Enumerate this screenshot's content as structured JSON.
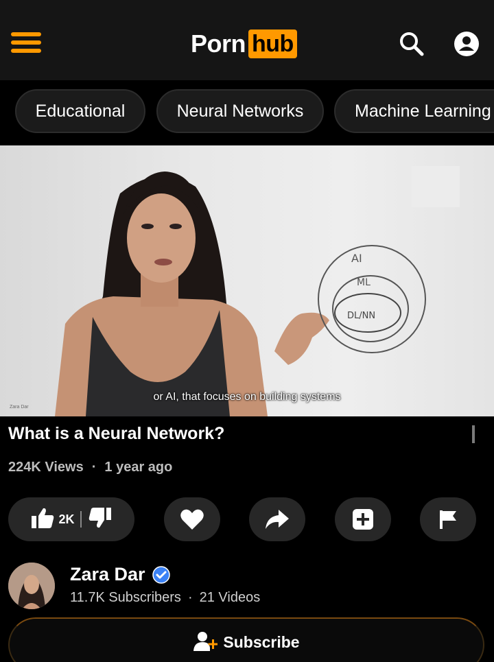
{
  "header": {
    "logo_left": "Porn",
    "logo_right": "hub",
    "menu_icon": "hamburger-icon",
    "search_icon": "search-icon",
    "account_icon": "user-icon"
  },
  "tags": [
    "Educational",
    "Neural Networks",
    "Machine Learning"
  ],
  "video": {
    "caption": "or AI, that focuses on building systems",
    "watermark": "Zara Dar",
    "whiteboard": {
      "outer": "AI",
      "middle": "ML",
      "inner": "DL/NN"
    },
    "title": "What is a Neural Network?",
    "views": "224K Views",
    "age": "1 year ago"
  },
  "actions": {
    "like_count": "2K",
    "icons": [
      "thumbs-up-icon",
      "thumbs-down-icon",
      "heart-icon",
      "share-icon",
      "add-playlist-icon",
      "flag-icon"
    ]
  },
  "channel": {
    "name": "Zara Dar",
    "subscribers": "11.7K Subscribers",
    "videos": "21 Videos",
    "subscribe_label": "Subscribe"
  },
  "colors": {
    "brand": "#ff9900",
    "background": "#000000",
    "header": "#151515",
    "chip": "#1b1b1b",
    "verified": "#3b82f6"
  }
}
